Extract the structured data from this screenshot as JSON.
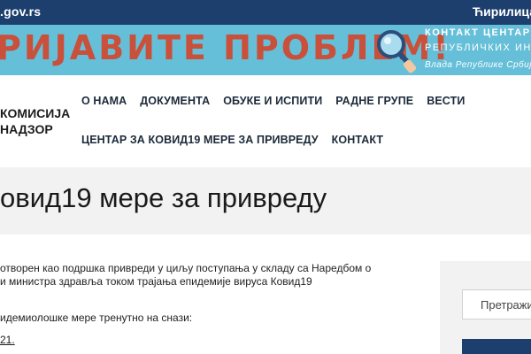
{
  "topbar": {
    "domain": ".gov.rs",
    "language": "Ћирилица"
  },
  "banner": {
    "headline": "РИЈАВИТЕ ПРОБЛЕМ!",
    "contact_line1": "КОНТАКТ ЦЕНТАР",
    "contact_line2": "РЕПУБЛИЧКИХ ИНСПЕКЦИЈА",
    "contact_line3": "Влада Републике Србије",
    "icon": "magnifier-icon"
  },
  "header": {
    "site_name_line1": "КОМИСИЈА",
    "site_name_line2": "НАДЗОР",
    "nav_row1": [
      "О НАМА",
      "ДОКУМЕНТА",
      "ОБУКЕ И ИСПИТИ",
      "РАДНЕ ГРУПЕ",
      "ВЕСТИ"
    ],
    "nav_row2": [
      "ЦЕНТАР ЗА КОВИД19 МЕРЕ ЗА ПРИВРЕДУ",
      "КОНТАКТ"
    ]
  },
  "page": {
    "title": "овид19 мере за привреду"
  },
  "content": {
    "p1_line1": "отворен као подршка привреди у циљу поступања у складу са Наредбом о",
    "p1_line2": "и министра здравља током трајања епидемије вируса Ковид19",
    "p2": "идемиолошке мере тренутно на снази:",
    "p3": "21."
  },
  "sidebar": {
    "search_placeholder": "Претражи"
  },
  "colors": {
    "topbar": "#1c3f6e",
    "banner": "#66bfd8",
    "headline": "#c9503a",
    "title_band": "#f2f2f2"
  }
}
